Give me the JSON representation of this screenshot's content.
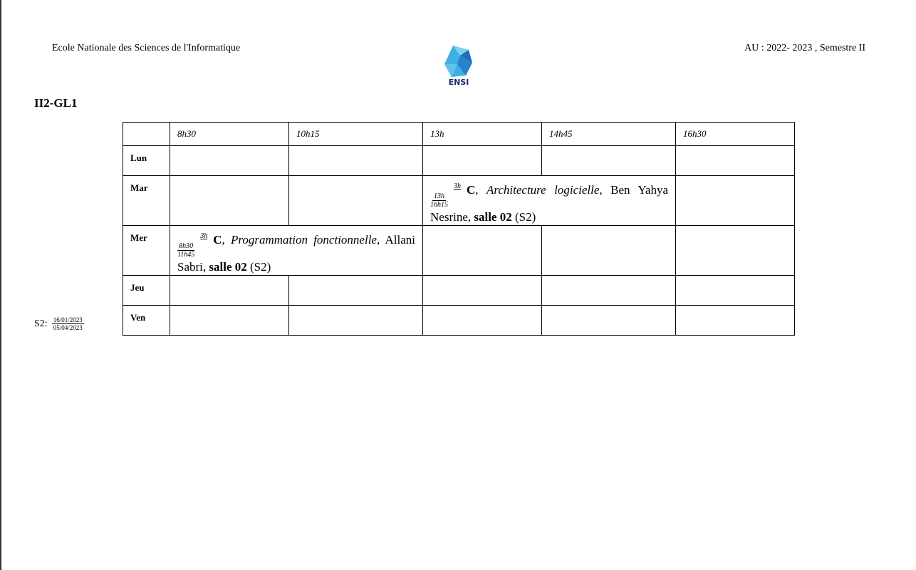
{
  "header": {
    "school": "Ecole Nationale des Sciences de l'Informatique",
    "logo_text": "ENSI",
    "year": "AU : 2022- 2023 , Semestre II"
  },
  "title": "II2-GL1",
  "table": {
    "times": [
      "8h30",
      "10h15",
      "13h",
      "14h45",
      "16h30"
    ],
    "days": [
      "Lun",
      "Mar",
      "Mer",
      "Jeu",
      "Ven"
    ],
    "mar_event": {
      "start": "13h",
      "end": "16h15",
      "duration": "3h",
      "type": "C",
      "course": "Architecture logicielle",
      "teacher": "Ben Yahya Nesrine",
      "room": "salle 02",
      "period": "(S2)"
    },
    "mer_event": {
      "start": "8h30",
      "end": "11h45",
      "duration": "3h",
      "type": "C",
      "course": "Programmation fonctionnelle",
      "teacher": "Allani Sabri",
      "room": "salle 02",
      "period": "(S2)"
    }
  },
  "footer": {
    "label": "S2:",
    "start": "16/01/2023",
    "end": "05/04/2023"
  }
}
